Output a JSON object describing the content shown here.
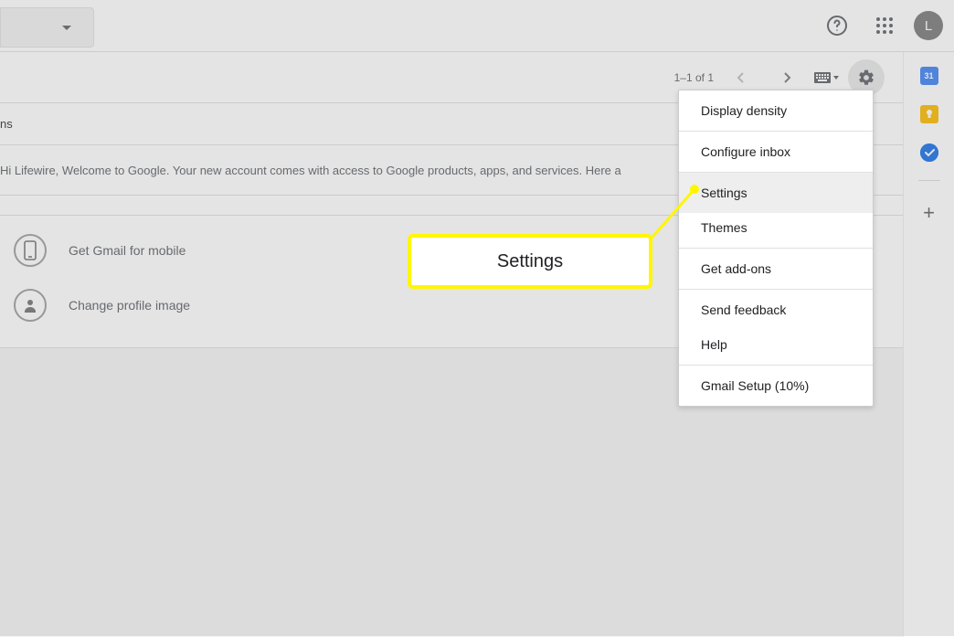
{
  "header": {
    "avatar_letter": "L"
  },
  "toolbar": {
    "pagination": "1–1 of 1"
  },
  "content": {
    "row1_text_fragment": "ns",
    "row2_text_fragment": "Hi Lifewire, Welcome to Google. Your new account comes with access to Google products, apps, and services. Here a",
    "list": [
      {
        "label": "Get Gmail for mobile"
      },
      {
        "label": "Change profile image"
      }
    ]
  },
  "dropdown": {
    "items": [
      "Display density",
      "Configure inbox",
      "Settings",
      "Themes",
      "Get add-ons",
      "Send feedback",
      "Help",
      "Gmail Setup (10%)"
    ],
    "highlighted": "Settings"
  },
  "callout": {
    "label": "Settings"
  },
  "sidepanel": {
    "calendar_day": "31"
  }
}
